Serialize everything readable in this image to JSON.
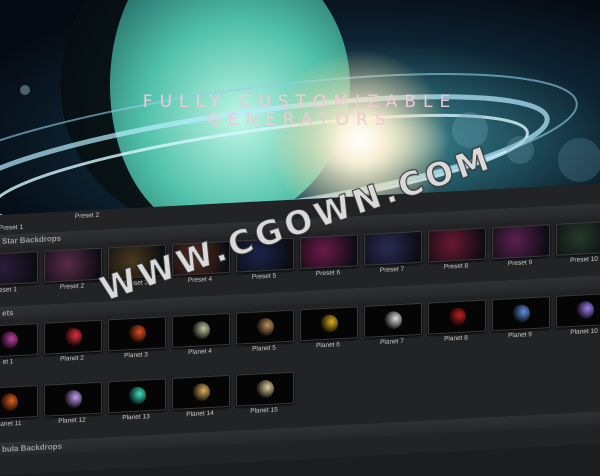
{
  "hero": {
    "line1": "FULLY CUSTOMIZABLE",
    "line2": "GENERATORS"
  },
  "top_labels": [
    "Preset 1",
    "Preset 2"
  ],
  "sections": {
    "star_backdrops": "Star Backdrops",
    "planets": "ets",
    "nebula_backdrops": "bula Backdrops"
  },
  "star_presets": [
    {
      "label": "eset 1",
      "color": "#2a1c3a"
    },
    {
      "label": "Preset 2",
      "color": "#5a2a46"
    },
    {
      "label": "Preset 3",
      "color": "#4a3a1c"
    },
    {
      "label": "Preset 4",
      "color": "#5a2c1a"
    },
    {
      "label": "Preset 5",
      "color": "#1a2448"
    },
    {
      "label": "Preset 6",
      "color": "#6a1a48"
    },
    {
      "label": "Preset 7",
      "color": "#2a2a52"
    },
    {
      "label": "Preset 8",
      "color": "#6a1830"
    },
    {
      "label": "Preset 9",
      "color": "#5a2050"
    },
    {
      "label": "Preset 10",
      "color": "#243a2a"
    }
  ],
  "planets_row1": [
    {
      "label": "et 1",
      "color": "#c040a0"
    },
    {
      "label": "Planet 2",
      "color": "#e03040"
    },
    {
      "label": "Planet 3",
      "color": "#e05020"
    },
    {
      "label": "Planet 4",
      "color": "#c0c8a0"
    },
    {
      "label": "Planet 5",
      "color": "#c09060"
    },
    {
      "label": "Planet 6",
      "color": "#e0b020"
    },
    {
      "label": "Planet 7",
      "color": "#e0e0e0"
    },
    {
      "label": "Planet 8",
      "color": "#c02020"
    },
    {
      "label": "Planet 9",
      "color": "#6090e0"
    },
    {
      "label": "Planet 10",
      "color": "#a080f0"
    }
  ],
  "planets_row2": [
    {
      "label": "Planet 11",
      "color": "#e06020"
    },
    {
      "label": "Planet 12",
      "color": "#c0a0f0"
    },
    {
      "label": "Planet 13",
      "color": "#40e0c0"
    },
    {
      "label": "Planet 14",
      "color": "#e0b060"
    },
    {
      "label": "Planet 15",
      "color": "#e0d0a0"
    }
  ],
  "watermark": "WWW.CGOWN.COM"
}
